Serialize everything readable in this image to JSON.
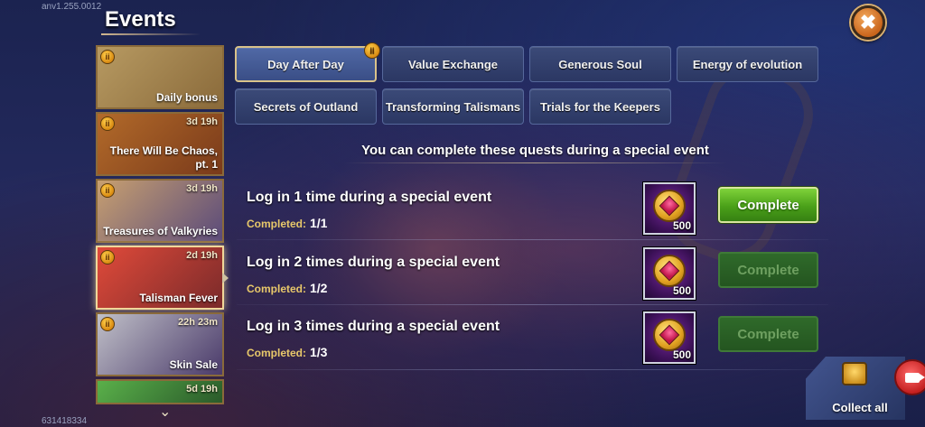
{
  "version_label": "anv1.255.0012",
  "build_id": "631418334",
  "header": {
    "title": "Events",
    "close_symbol": "✖"
  },
  "sidebar": {
    "items": [
      {
        "label": "Daily bonus",
        "timer": "",
        "has_badge": true,
        "colors": [
          "#8a6a3a",
          "#b79a62"
        ]
      },
      {
        "label": "There Will Be Chaos, pt. 1",
        "timer": "3d 19h",
        "has_badge": true,
        "colors": [
          "#7a3a1a",
          "#b26a2a"
        ]
      },
      {
        "label": "Treasures of Valkyries",
        "timer": "3d 19h",
        "has_badge": true,
        "colors": [
          "#5a4a7a",
          "#c8a070"
        ]
      },
      {
        "label": "Talisman Fever",
        "timer": "2d 19h",
        "has_badge": true,
        "colors": [
          "#7a2a2a",
          "#e04a3a"
        ]
      },
      {
        "label": "Skin Sale",
        "timer": "22h 23m",
        "has_badge": true,
        "colors": [
          "#4a3a6a",
          "#c0c0c8"
        ]
      },
      {
        "label": "",
        "timer": "5d 19h",
        "has_badge": false,
        "colors": [
          "#2a5a2a",
          "#5ab04a"
        ]
      }
    ],
    "scroll_symbol": "⌄"
  },
  "tabs": [
    {
      "label": "Day After Day",
      "active": true,
      "has_badge": true
    },
    {
      "label": "Value Exchange",
      "active": false,
      "has_badge": false
    },
    {
      "label": "Generous Soul",
      "active": false,
      "has_badge": false
    },
    {
      "label": "Energy of evolution",
      "active": false,
      "has_badge": false
    },
    {
      "label": "Secrets of Outland",
      "active": false,
      "has_badge": false
    },
    {
      "label": "Transforming Talismans",
      "active": false,
      "has_badge": false
    },
    {
      "label": "Trials for the Keepers",
      "active": false,
      "has_badge": false
    }
  ],
  "main": {
    "heading": "You can complete these quests during a special event",
    "quests": [
      {
        "text": "Log in 1 time during a special event",
        "progress_label": "Completed:",
        "progress_value": "1/1",
        "reward_count": "500",
        "button_label": "Complete",
        "enabled": true
      },
      {
        "text": "Log in 2 times during a special event",
        "progress_label": "Completed:",
        "progress_value": "1/2",
        "reward_count": "500",
        "button_label": "Complete",
        "enabled": false
      },
      {
        "text": "Log in 3 times during a special event",
        "progress_label": "Completed:",
        "progress_value": "1/3",
        "reward_count": "500",
        "button_label": "Complete",
        "enabled": false
      }
    ]
  },
  "collect_all": {
    "label": "Collect all"
  },
  "badge_symbol": "ii"
}
